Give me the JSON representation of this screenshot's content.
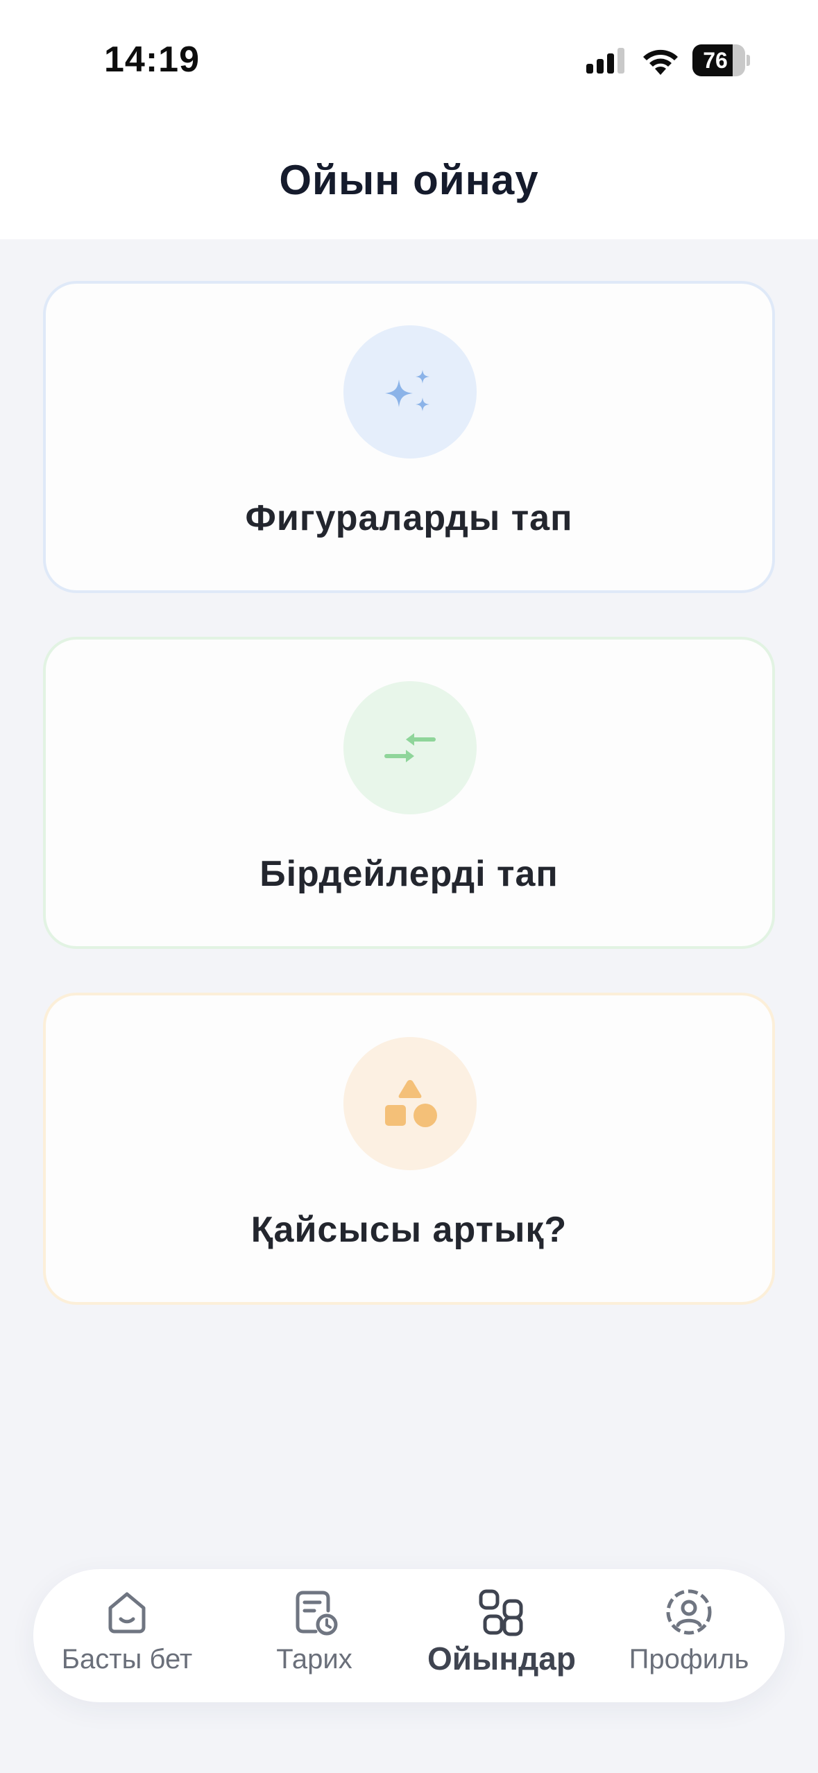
{
  "status_bar": {
    "time": "14:19",
    "battery_level": "76",
    "battery_fraction": 0.76,
    "icons": [
      "signal-icon",
      "wifi-icon",
      "battery-icon"
    ]
  },
  "header": {
    "title": "Ойын ойнау"
  },
  "games": [
    {
      "label": "Фигураларды тап",
      "icon": "sparkles-icon",
      "accent": "#8bb3e8",
      "circle": "#e5eefb",
      "border": "#dfe9f8"
    },
    {
      "label": "Бірдейлерді тап",
      "icon": "swap-arrows-icon",
      "accent": "#8fd59a",
      "circle": "#e8f6ea",
      "border": "#e2f3e3"
    },
    {
      "label": "Қайсысы артық?",
      "icon": "shapes-icon",
      "accent": "#f4c078",
      "circle": "#fcf0e2",
      "border": "#fcefd9"
    }
  ],
  "bottom_nav": {
    "items": [
      {
        "label": "Басты бет",
        "icon": "home-icon",
        "active": false
      },
      {
        "label": "Тарих",
        "icon": "history-icon",
        "active": false
      },
      {
        "label": "Ойындар",
        "icon": "games-grid-icon",
        "active": true
      },
      {
        "label": "Профиль",
        "icon": "profile-icon",
        "active": false
      }
    ]
  }
}
